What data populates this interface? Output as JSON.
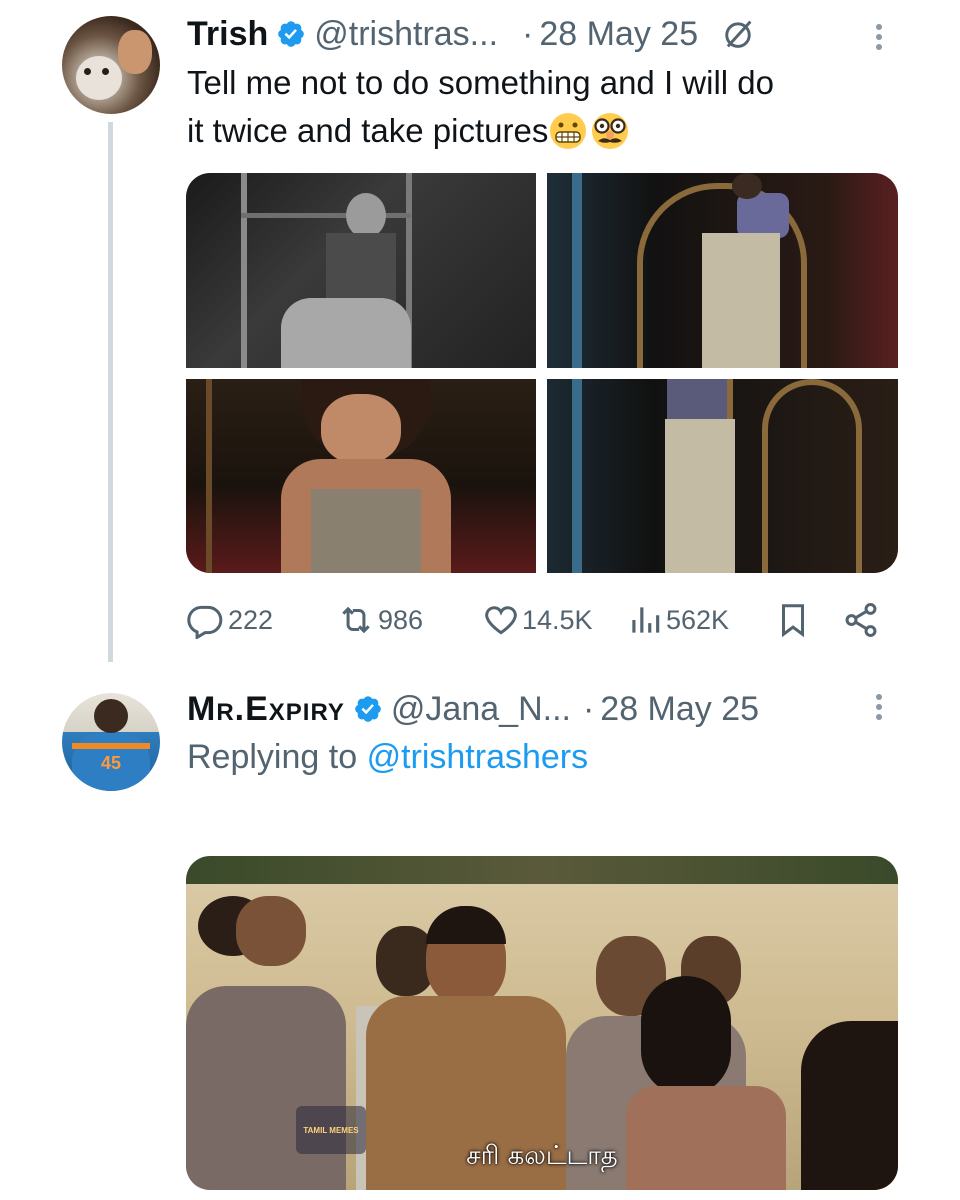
{
  "tweet1": {
    "name": "Trish",
    "handle": "@trishtras...",
    "separator": "·",
    "date": "28 May 25",
    "text_line1": "Tell me not to do something and I will do",
    "text_line2": "it twice and take pictures",
    "emojis": [
      "grimacing-face",
      "disguised-face"
    ],
    "stats": {
      "replies": "222",
      "retweets": "986",
      "likes": "14.5K",
      "views": "562K"
    }
  },
  "tweet2": {
    "name": "Mr.Expiry",
    "handle": "@Jana_N...",
    "separator": "·",
    "date": "28 May 25",
    "replying_prefix": "Replying to",
    "replying_mention": "@trishtrashers",
    "media_subtitle": "சரி கலட்டாத",
    "watermark": "TAMIL MEMES"
  },
  "colors": {
    "verified": "#1d9bf0",
    "muted": "#536471",
    "link": "#1d9bf0",
    "thread_line": "#cfd9de"
  },
  "icons": [
    "verified-badge-icon",
    "grok-icon",
    "more-icon",
    "reply-icon",
    "retweet-icon",
    "like-icon",
    "views-icon",
    "bookmark-icon",
    "share-icon"
  ]
}
